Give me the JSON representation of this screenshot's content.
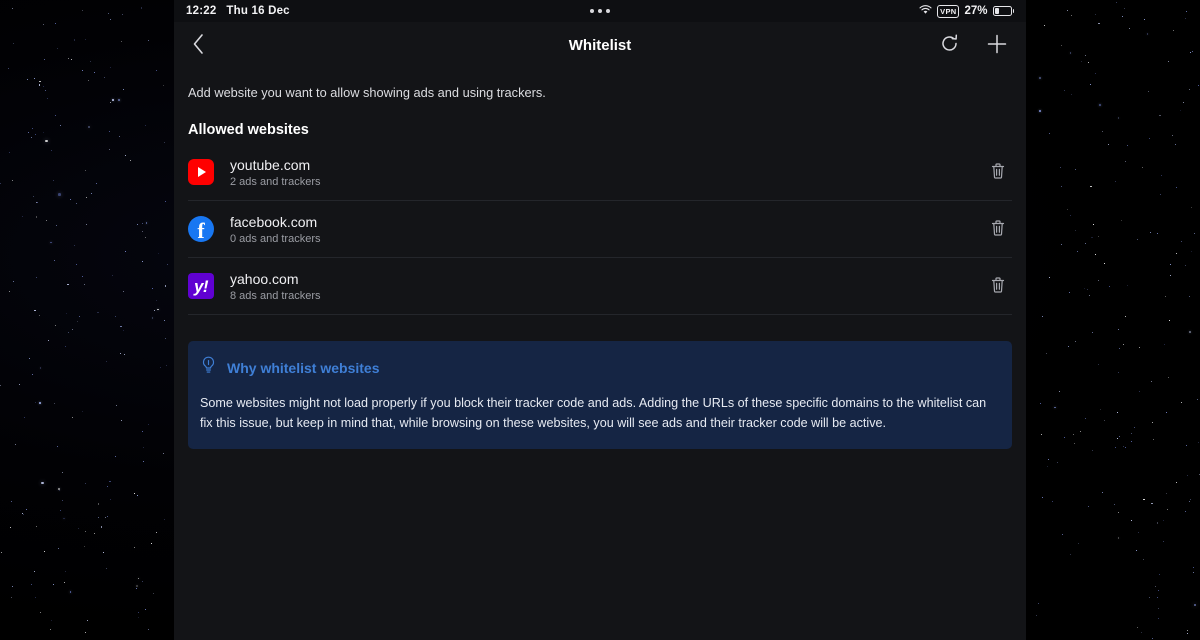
{
  "status_bar": {
    "time": "12:22",
    "date": "Thu 16 Dec",
    "dots_icon": "more-dots-icon",
    "wifi_icon": "wifi-icon",
    "vpn_label": "VPN",
    "battery_percent": "27%",
    "battery_level": 27,
    "battery_icon": "battery-icon"
  },
  "nav": {
    "back_icon": "chevron-left-icon",
    "title": "Whitelist",
    "refresh_icon": "refresh-icon",
    "add_icon": "plus-icon"
  },
  "main": {
    "intro": "Add website you want to allow showing ads and using trackers.",
    "section_title": "Allowed websites",
    "sites": [
      {
        "domain": "youtube.com",
        "subtitle": "2 ads and trackers",
        "favicon": "youtube-icon",
        "favicon_color": "#ff0000",
        "delete_icon": "trash-icon"
      },
      {
        "domain": "facebook.com",
        "subtitle": "0 ads and trackers",
        "favicon": "facebook-icon",
        "favicon_color": "#1877f2",
        "delete_icon": "trash-icon"
      },
      {
        "domain": "yahoo.com",
        "subtitle": "8 ads and trackers",
        "favicon": "yahoo-icon",
        "favicon_color": "#6001d2",
        "delete_icon": "trash-icon"
      }
    ]
  },
  "info_card": {
    "icon": "lightbulb-icon",
    "title": "Why whitelist websites",
    "body": "Some websites might not load properly if you block their tracker code and ads. Adding the URLs of these specific domains to the whitelist can fix this issue, but keep in mind that, while browsing on these websites, you will see ads and their tracker code will be active.",
    "accent_color": "#3f7fd6",
    "background_color": "#152544"
  },
  "theme": {
    "panel_background": "#131417",
    "wallpaper": "starfield-night-sky"
  }
}
